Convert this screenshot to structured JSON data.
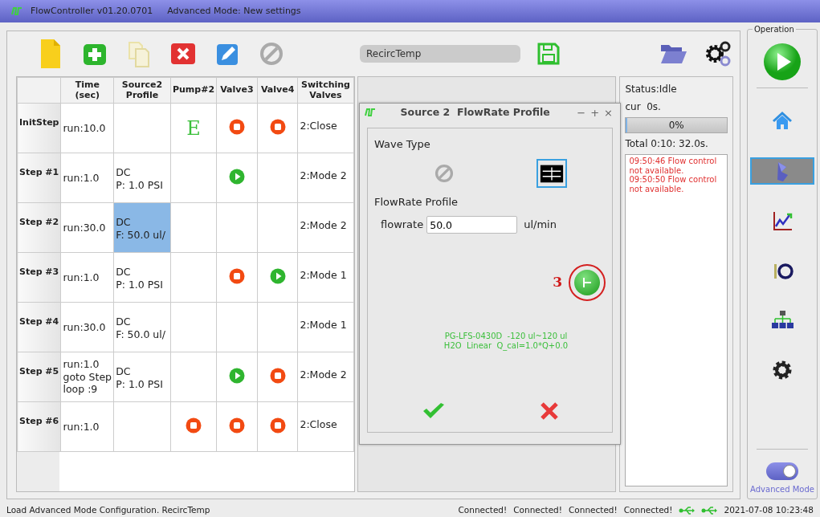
{
  "window": {
    "title": "FlowController v01.20.0701",
    "mode": "Advanced Mode: New settings"
  },
  "toolbar": {
    "buttons": [
      {
        "kind": "new",
        "disabled": false
      },
      {
        "kind": "add",
        "disabled": false
      },
      {
        "kind": "copy",
        "disabled": true
      },
      {
        "kind": "delete",
        "disabled": false
      },
      {
        "kind": "edit",
        "disabled": false
      },
      {
        "kind": "disable",
        "disabled": false
      }
    ],
    "config_name": "RecircTemp"
  },
  "table": {
    "columns": [
      [
        "Time",
        "(sec)"
      ],
      [
        "Source2",
        "Profile"
      ],
      [
        "Pump#2"
      ],
      [
        "Valve3"
      ],
      [
        "Valve4"
      ],
      [
        "Switching",
        "Valves"
      ]
    ],
    "rows": [
      {
        "step": "InitStep",
        "time": [
          "run:10.0"
        ],
        "source_selected": false,
        "pump2": {
          "kind": "letter",
          "text": "E"
        },
        "valve3": {
          "kind": "stop"
        },
        "valve4": {
          "kind": "stop"
        },
        "switching": "2:Close"
      },
      {
        "step": "Step #1",
        "time": [
          "run:1.0"
        ],
        "source": [
          "DC",
          "P: 1.0 PSI"
        ],
        "source_selected": false,
        "valve3": {
          "kind": "play"
        },
        "switching": "2:Mode 2"
      },
      {
        "step": "Step #2",
        "time": [
          "run:30.0"
        ],
        "source": [
          "DC",
          "F: 50.0 ul/"
        ],
        "source_selected": true,
        "switching": "2:Mode 2"
      },
      {
        "step": "Step #3",
        "time": [
          "run:1.0"
        ],
        "source": [
          "DC",
          "P: 1.0 PSI"
        ],
        "source_selected": false,
        "valve3": {
          "kind": "stop"
        },
        "valve4": {
          "kind": "play"
        },
        "switching": "2:Mode 1"
      },
      {
        "step": "Step #4",
        "time": [
          "run:30.0"
        ],
        "source": [
          "DC",
          "F: 50.0 ul/"
        ],
        "source_selected": false,
        "switching": "2:Mode 1"
      },
      {
        "step": "Step #5",
        "time": [
          "run:1.0",
          "goto Step",
          "loop :9"
        ],
        "source": [
          "DC",
          "P: 1.0 PSI"
        ],
        "source_selected": false,
        "valve3": {
          "kind": "play"
        },
        "valve4": {
          "kind": "stop"
        },
        "switching": "2:Mode 2"
      },
      {
        "step": "Step #6",
        "time": [
          "run:1.0"
        ],
        "source_selected": false,
        "pump2": {
          "kind": "stop"
        },
        "valve3": {
          "kind": "stop"
        },
        "valve4": {
          "kind": "stop"
        },
        "switching": "2:Close"
      }
    ]
  },
  "dialog": {
    "title": "Source 2  FlowRate Profile",
    "controls": [
      "−",
      "+",
      "×"
    ],
    "wave_type_label": "Wave Type",
    "wave_types": [
      {
        "kind": "none",
        "selected": false
      },
      {
        "kind": "dc",
        "selected": true
      }
    ],
    "profile_label": "FlowRate Profile",
    "field_label": "flowrate",
    "field_value": "50.0",
    "unit": "ul/min",
    "annotation": "3",
    "sensor_info": [
      "PG-LFS-0430D  -120 ul~120 ul",
      "H2O  Linear  Q_cal=1.0*Q+0.0"
    ]
  },
  "status_panel": {
    "status": "Status:Idle",
    "cur": "cur  0s.",
    "progress": {
      "level": 0.01,
      "text": "0%"
    },
    "total": "Total 0:10: 32.0s.",
    "log": [
      "09:50:46 Flow control not available.",
      "09:50:50 Flow control not available."
    ]
  },
  "operation": {
    "legend": "Operation",
    "nav": [
      {
        "kind": "home",
        "selected": false
      },
      {
        "kind": "profile",
        "selected": true
      },
      {
        "kind": "chart",
        "selected": false
      },
      {
        "kind": "io",
        "selected": false
      },
      {
        "kind": "network",
        "selected": false
      },
      {
        "kind": "settings",
        "selected": false
      }
    ],
    "advanced_mode": {
      "on": true,
      "label": "Advanced Mode"
    }
  },
  "status_bar": {
    "message": "Load Advanced Mode Configuration. RecircTemp",
    "connections": [
      "Connected!",
      "Connected!",
      "Connected!",
      "Connected!"
    ],
    "datetime": "2021-07-08 10:23:48"
  }
}
